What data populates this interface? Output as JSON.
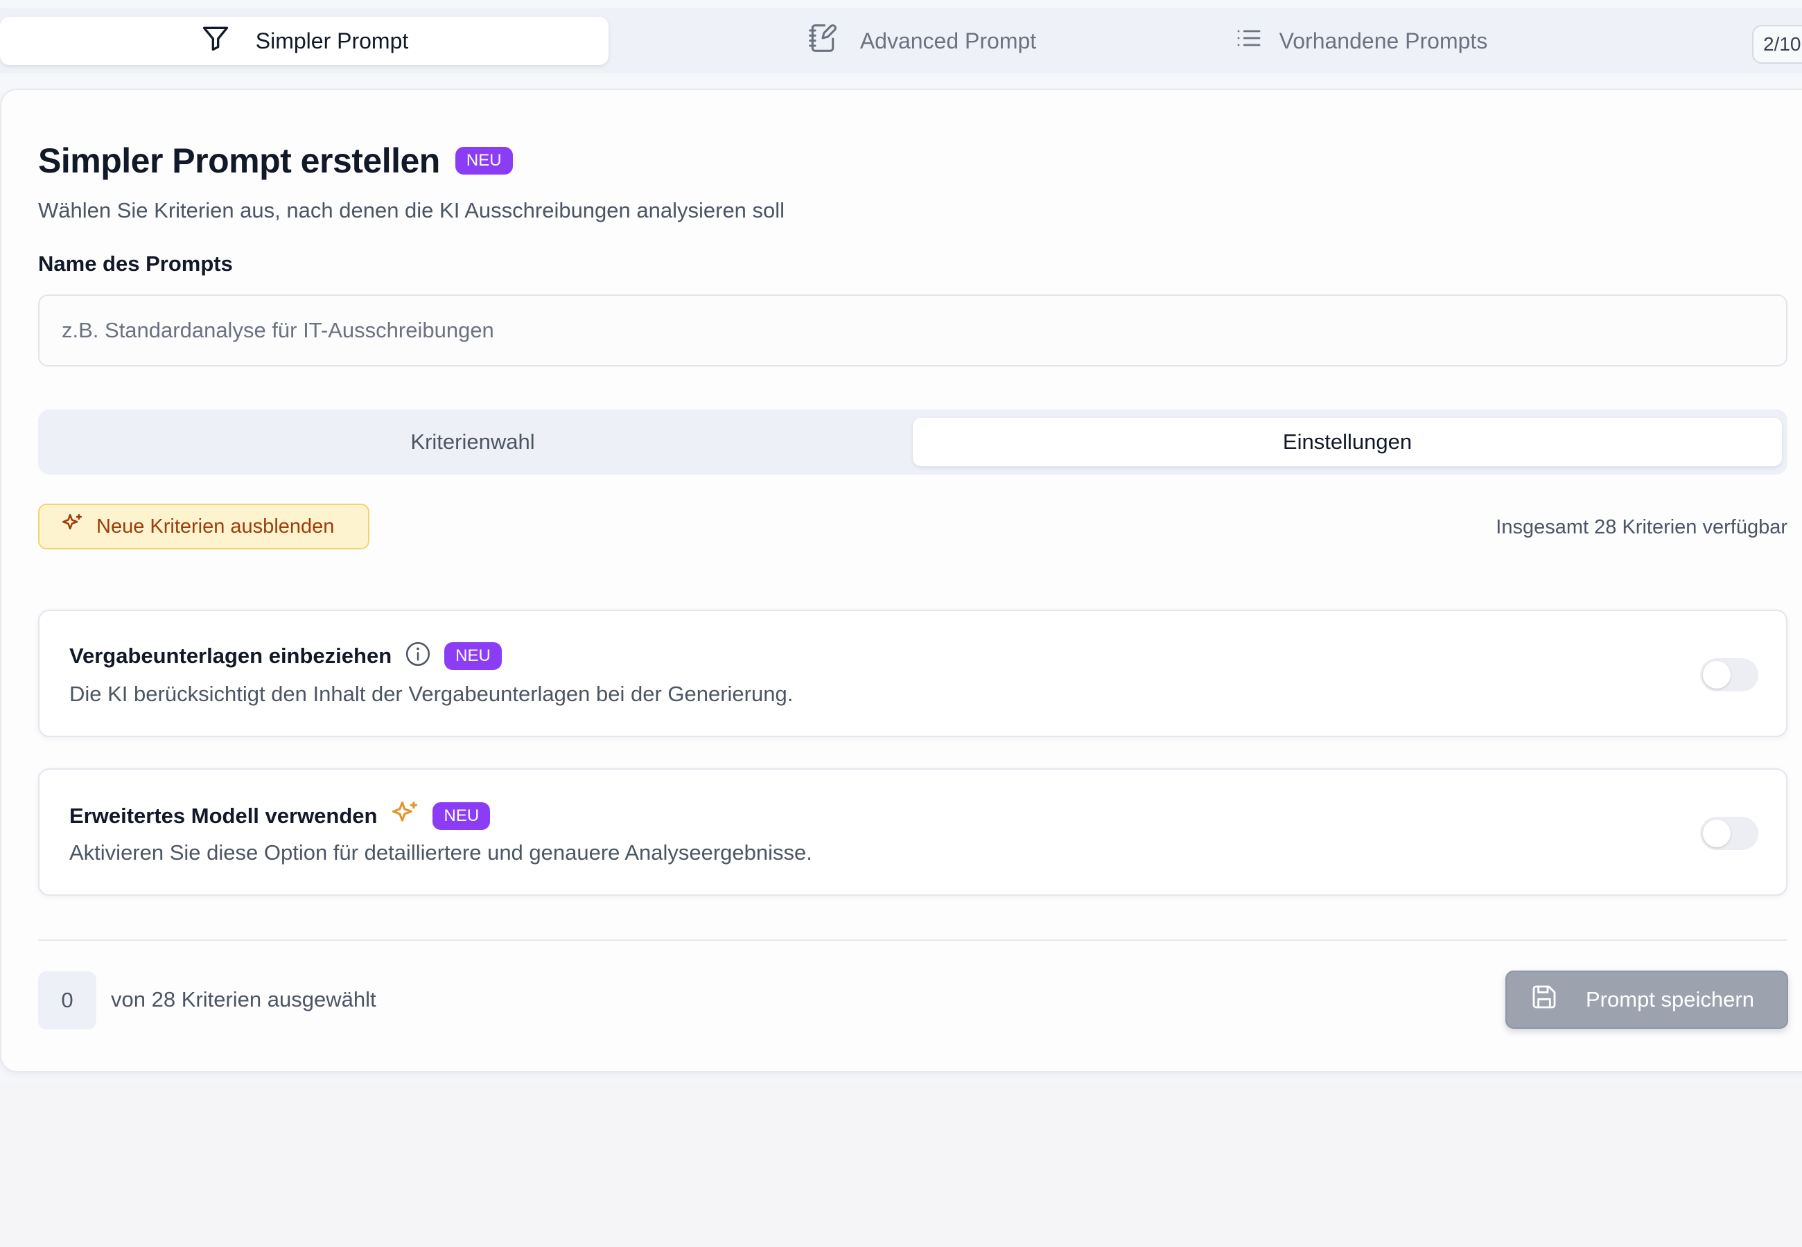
{
  "tabs": [
    {
      "label": "Simpler Prompt",
      "icon": "filter-icon",
      "active": true
    },
    {
      "label": "Advanced Prompt",
      "icon": "notebook-pen-icon",
      "active": false
    },
    {
      "label": "Vorhandene Prompts",
      "icon": "list-icon",
      "active": false
    }
  ],
  "prompt_count": "2/10",
  "header": {
    "title": "Simpler Prompt erstellen",
    "badge": "NEU",
    "subtitle": "Wählen Sie Kriterien aus, nach denen die KI Ausschreibungen analysieren soll"
  },
  "name_field": {
    "label": "Name des Prompts",
    "value": "",
    "placeholder": "z.B. Standardanalyse für IT-Ausschreibungen"
  },
  "segments": [
    {
      "label": "Kriterienwahl",
      "active": false
    },
    {
      "label": "Einstellungen",
      "active": true
    }
  ],
  "new_criteria_button": {
    "label": "Neue Kriterien ausblenden",
    "icon": "sparkles-icon"
  },
  "total_criteria": "Insgesamt 28 Kriterien verfügbar",
  "options": [
    {
      "title": "Vergabeunterlagen einbeziehen",
      "icon": "info-icon",
      "badge": "NEU",
      "description": "Die KI berücksichtigt den Inhalt der Vergabeunterlagen bei der Generierung.",
      "enabled": false
    },
    {
      "title": "Erweitertes Modell verwenden",
      "icon": "sparkles-icon",
      "badge": "NEU",
      "description": "Aktivieren Sie diese Option für detailliertere und genauere Analyseergebnisse.",
      "enabled": false
    }
  ],
  "footer": {
    "selected_count": "0",
    "selected_text": "von 28 Kriterien ausgewählt",
    "save_label": "Prompt speichern",
    "save_icon": "save-icon"
  },
  "colors": {
    "badge": "#8b3df5",
    "warning_bg": "#fdf3cf",
    "warning_text": "#9a3e0a",
    "sparkle_accent": "#e0962a",
    "save_disabled": "#9ca3af"
  }
}
